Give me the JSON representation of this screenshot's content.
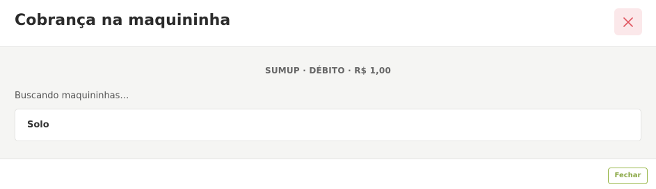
{
  "modal": {
    "title": "Cobrança na maquininha",
    "close_icon": "close-x-icon",
    "close_icon_color": "#e0555f",
    "close_bg_color": "#fbe8ea"
  },
  "body": {
    "summary": "SUMUP · DÉBITO · R$ 1,00",
    "status": "Buscando maquininhas…",
    "devices": [
      {
        "name": "Solo"
      }
    ]
  },
  "footer": {
    "close_label": "Fechar",
    "accent_color": "#8aa845"
  }
}
